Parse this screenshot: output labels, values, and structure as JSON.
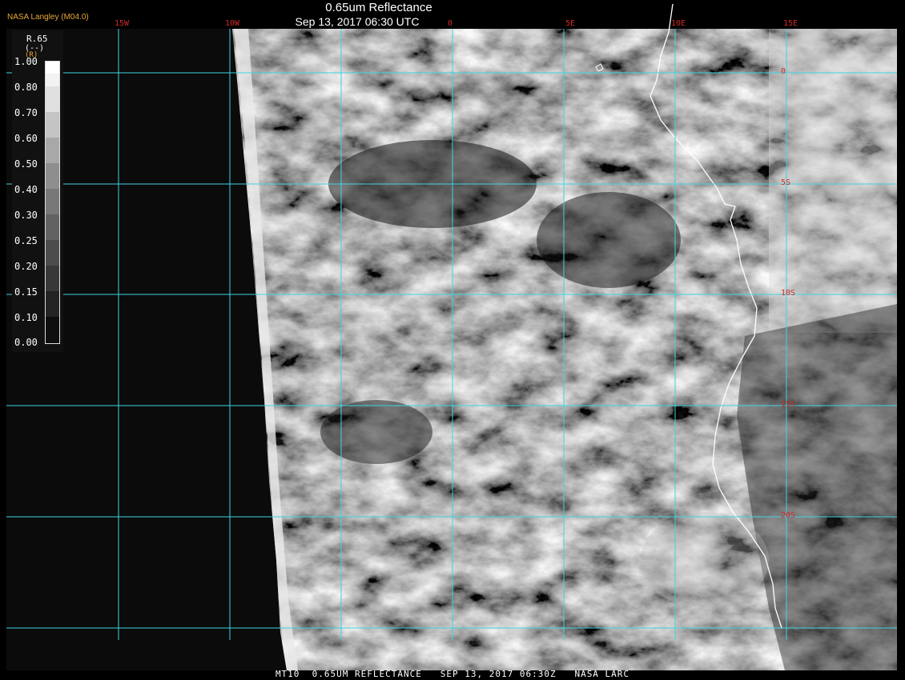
{
  "header": {
    "title": "0.65um Reflectance",
    "datetime": "Sep 13, 2017 06:30 UTC",
    "logo": "NASA Langley (M04.0)"
  },
  "longitude_labels": [
    "15W",
    "10W",
    "0",
    "5E",
    "10E",
    "15E"
  ],
  "latitude_labels": [
    "0",
    "5S",
    "10S",
    "15S",
    "20S"
  ],
  "colorbar": {
    "label": "R.65",
    "units": "(--)",
    "bracket": "(R)",
    "ticks": [
      "1.00",
      "0.80",
      "0.70",
      "0.60",
      "0.50",
      "0.40",
      "0.30",
      "0.25",
      "0.20",
      "0.15",
      "0.10",
      "0.00"
    ]
  },
  "footer": "MT10  0.65UM REFLECTANCE   SEP 13, 2017 06:30Z   NASA LARC",
  "colors": {
    "grid": "#3fd3e0",
    "label": "#d02a2a",
    "coastline": "#ffffff",
    "logo": "#e8a838"
  }
}
